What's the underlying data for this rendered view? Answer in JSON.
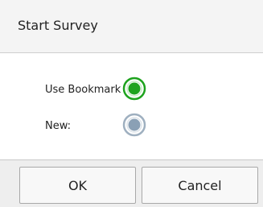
{
  "dialog": {
    "title": "Start Survey"
  },
  "options": [
    {
      "label": "Use Bookmark",
      "selected": true
    },
    {
      "label": "New:",
      "selected": false
    }
  ],
  "colors": {
    "selected_radio": "#1ea31e",
    "unselected_radio": "#8aa0b5"
  },
  "buttons": {
    "ok_label": "OK",
    "cancel_label": "Cancel"
  }
}
